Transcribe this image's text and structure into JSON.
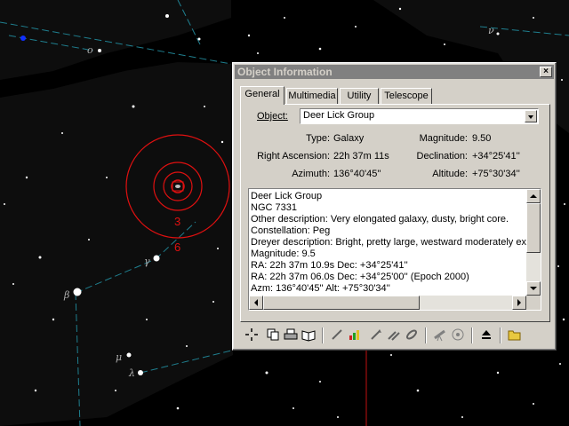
{
  "sky": {
    "labels": {
      "omicron": "ο",
      "beta": "β",
      "gamma": "γ",
      "lambda": "λ",
      "mu": "μ",
      "nu": "ν",
      "ring_3": "3",
      "ring_6": "6"
    }
  },
  "dialog": {
    "title": "Object Information",
    "close_label": "×",
    "tabs": [
      "General",
      "Multimedia",
      "Utility",
      "Telescope"
    ],
    "active_tab": "General",
    "object_label": "Object:",
    "object_value": "Deer Lick Group",
    "fields": {
      "type_label": "Type:",
      "type_value": "Galaxy",
      "magnitude_label": "Magnitude:",
      "magnitude_value": "9.50",
      "ra_label": "Right Ascension:",
      "ra_value": "22h 37m 11s",
      "dec_label": "Declination:",
      "dec_value": "+34°25'41''",
      "az_label": "Azimuth:",
      "az_value": "136°40'45''",
      "alt_label": "Altitude:",
      "alt_value": "+75°30'34''"
    },
    "description_lines": [
      "Deer Lick Group",
      "NGC 7331",
      "Other description: Very elongated galaxy, dusty, bright core.",
      "Constellation:  Peg",
      "Dreyer description: Bright, pretty large, westward moderately exten",
      "Magnitude:  9.5",
      "RA: 22h 37m 10.9s  Dec: +34°25'41''",
      "RA: 22h 37m 06.0s  Dec: +34°25'00''  (Epoch 2000)",
      "Azm: 136°40'45''  Alt: +75°30'34''"
    ],
    "toolbar_icons": [
      "center-object-icon",
      "copy-icon",
      "print-icon",
      "book-icon",
      "pencil-icon",
      "chart-icon",
      "edit-arrow-icon",
      "edit-multi-icon",
      "link-icon",
      "telescope-icon",
      "target-icon",
      "up-arrow-icon",
      "open-folder-icon"
    ]
  }
}
